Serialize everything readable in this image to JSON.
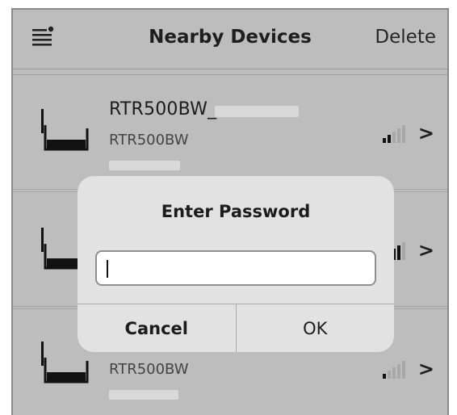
{
  "navbar": {
    "title": "Nearby Devices",
    "action_label": "Delete",
    "menu_icon": "list-settings-icon"
  },
  "devices": [
    {
      "name": "RTR500BW_",
      "model": "RTR500BW",
      "signal_bars": 2,
      "chevron": ">"
    },
    {
      "name": "",
      "model": "",
      "signal_bars": 4,
      "chevron": ">"
    },
    {
      "name": "",
      "model": "RTR500BW",
      "signal_bars": 1,
      "chevron": ">"
    }
  ],
  "dialog": {
    "title": "Enter Password",
    "input_value": "",
    "cancel_label": "Cancel",
    "ok_label": "OK"
  },
  "colors": {
    "background": "#bdbdbd",
    "dialog": "#e2e2e2",
    "text": "#1c1c1c"
  }
}
